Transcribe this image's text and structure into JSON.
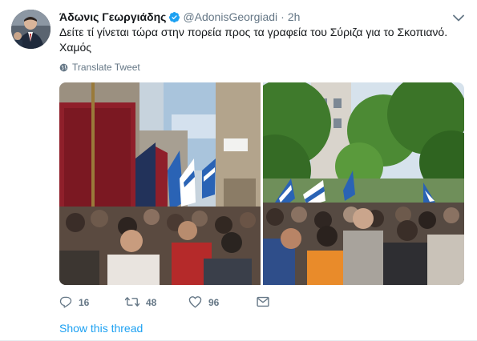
{
  "author": {
    "display_name": "Άδωνις Γεωργιάδης",
    "handle": "@AdonisGeorgiadi",
    "separator": "·",
    "timestamp": "2h",
    "verified_icon": "verified-badge-icon",
    "avatar_icon": "profile-avatar"
  },
  "tweet": {
    "text": "Δείτε τί γίνεται τώρα στην πορεία προς τα γραφεία του Σύριζα για το Σκοπιανό. Χαμός",
    "translate_label": "Translate Tweet"
  },
  "media": {
    "photo_count": 2,
    "photos": [
      {
        "icon": "photo-march-banners"
      },
      {
        "icon": "photo-march-trees"
      }
    ]
  },
  "actions": {
    "reply_count": "16",
    "retweet_count": "48",
    "like_count": "96"
  },
  "show_thread_label": "Show this thread",
  "colors": {
    "link": "#1da1f2",
    "secondary_text": "#657786",
    "primary_text": "#14171a",
    "verified": "#1da1f2",
    "divider": "#e6ecf0"
  }
}
